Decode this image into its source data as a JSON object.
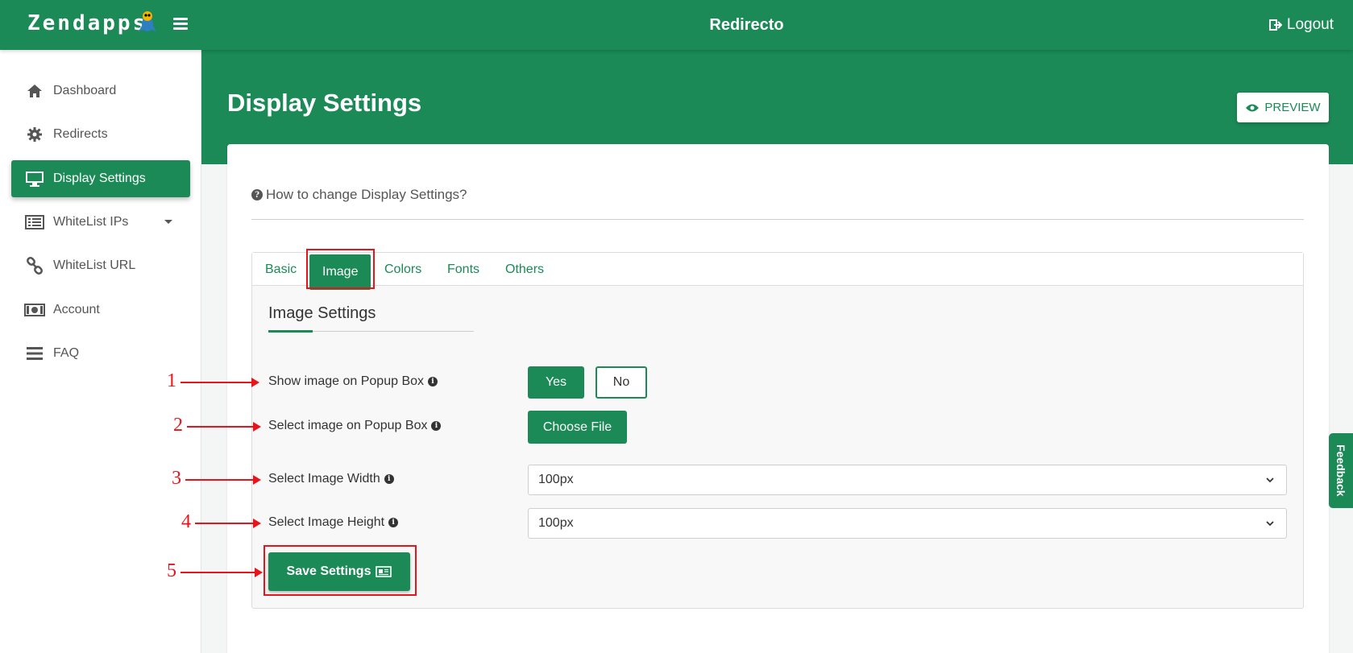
{
  "brand": {
    "name": "Zendapps"
  },
  "header": {
    "title": "Redirecto",
    "logout_label": "Logout"
  },
  "sidebar": {
    "items": [
      {
        "label": "Dashboard",
        "icon": "home-icon"
      },
      {
        "label": "Redirects",
        "icon": "gear-icon"
      },
      {
        "label": "Display Settings",
        "icon": "monitor-icon",
        "active": true
      },
      {
        "label": "WhiteList IPs",
        "icon": "list-icon",
        "has_dropdown": true
      },
      {
        "label": "WhiteList URL",
        "icon": "link-icon"
      },
      {
        "label": "Account",
        "icon": "money-icon"
      },
      {
        "label": "FAQ",
        "icon": "bars-icon"
      }
    ]
  },
  "page": {
    "title": "Display Settings",
    "preview_label": "PREVIEW"
  },
  "help": {
    "text": "How to change Display Settings?"
  },
  "tabs": [
    {
      "label": "Basic"
    },
    {
      "label": "Image",
      "active": true
    },
    {
      "label": "Colors"
    },
    {
      "label": "Fonts"
    },
    {
      "label": "Others"
    }
  ],
  "image_settings": {
    "title": "Image Settings",
    "show_image_label": "Show image on Popup Box",
    "yes_label": "Yes",
    "no_label": "No",
    "select_image_label": "Select image on Popup Box",
    "choose_file_label": "Choose File",
    "width_label": "Select Image Width",
    "width_value": "100px",
    "height_label": "Select Image Height",
    "height_value": "100px",
    "save_label": "Save Settings"
  },
  "annotations": [
    "1",
    "2",
    "3",
    "4",
    "5"
  ],
  "feedback_label": "Feedback",
  "colors": {
    "primary": "#1b8a57",
    "annotation": "#e8141b"
  }
}
